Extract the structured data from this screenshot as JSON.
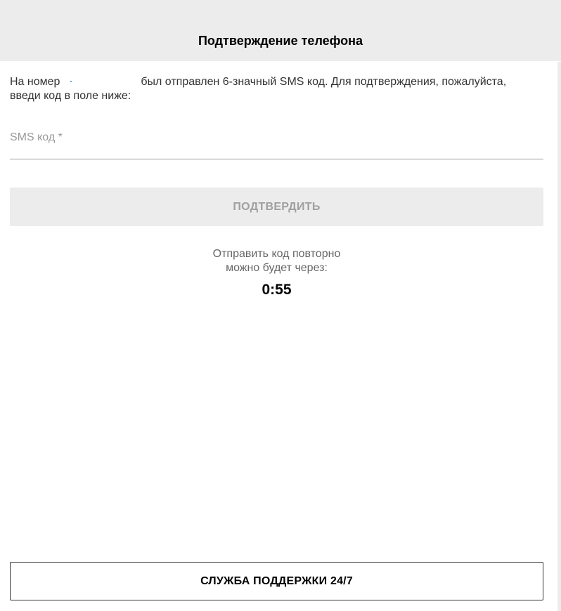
{
  "header": {
    "title": "Подтверждение телефона"
  },
  "intro": {
    "prefix": "На номер",
    "suffix": "был отправлен 6-значный SMS код. Для подтверждения, пожалуйста,",
    "line2": "введи код в поле ниже:"
  },
  "sms_field": {
    "placeholder": "SMS код *",
    "value": ""
  },
  "confirm_button": {
    "label": "ПОДТВЕРДИТЬ"
  },
  "resend": {
    "line1": "Отправить код повторно",
    "line2": "можно будет через:",
    "timer": "0:55"
  },
  "support_button": {
    "label": "СЛУЖБА ПОДДЕРЖКИ 24/7"
  },
  "colors": {
    "header_bg": "#ececec",
    "disabled_button_bg": "#ececec",
    "disabled_button_text": "#a0a0a0",
    "text": "#333333"
  }
}
